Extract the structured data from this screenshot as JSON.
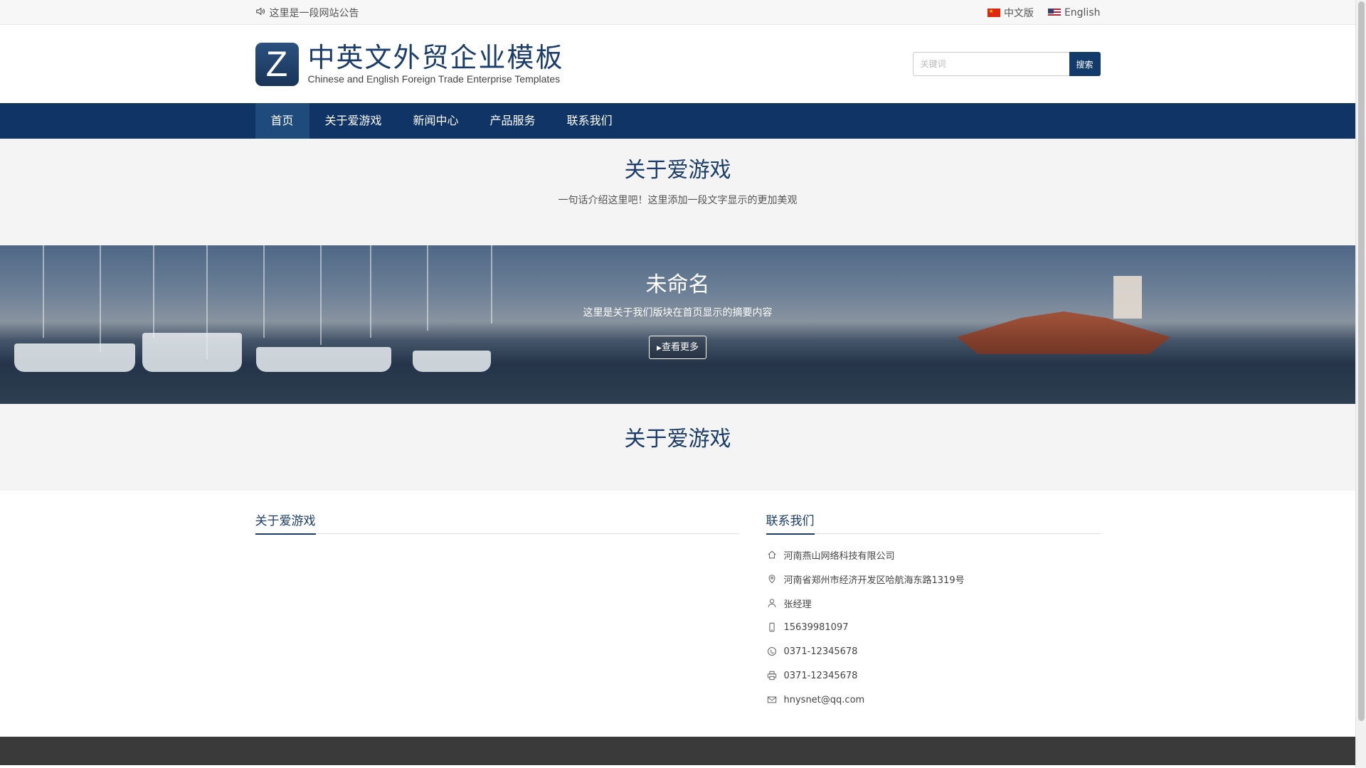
{
  "topbar": {
    "announcement": "这里是一段网站公告",
    "lang_cn": "中文版",
    "lang_en": "English"
  },
  "header": {
    "logo_letter": "Z",
    "title_cn": "中英文外贸企业模板",
    "title_en": "Chinese and English Foreign Trade Enterprise Templates",
    "search_placeholder": "关键词",
    "search_button": "搜索"
  },
  "nav": {
    "items": [
      {
        "label": "首页"
      },
      {
        "label": "关于爱游戏"
      },
      {
        "label": "新闻中心"
      },
      {
        "label": "产品服务"
      },
      {
        "label": "联系我们"
      }
    ]
  },
  "intro": {
    "title": "关于爱游戏",
    "subtitle": "一句话介绍这里吧！这里添加一段文字显示的更加美观"
  },
  "banner": {
    "title": "未命名",
    "summary": "这里是关于我们版块在首页显示的摘要内容",
    "more_button": "查看更多"
  },
  "about2": {
    "title": "关于爱游戏"
  },
  "bottom": {
    "left_title": "关于爱游戏",
    "right_title": "联系我们",
    "contacts": [
      {
        "icon": "home-icon",
        "text": "河南燕山网络科技有限公司"
      },
      {
        "icon": "location-icon",
        "text": "河南省郑州市经济开发区哈航海东路1319号"
      },
      {
        "icon": "user-icon",
        "text": "张经理"
      },
      {
        "icon": "mobile-icon",
        "text": "15639981097"
      },
      {
        "icon": "phone-icon",
        "text": "0371-12345678"
      },
      {
        "icon": "fax-icon",
        "text": "0371-12345678"
      },
      {
        "icon": "email-icon",
        "text": "hnysnet@qq.com"
      }
    ]
  },
  "colors": {
    "primary": "#0f3465",
    "nav_active": "#1f4a7c",
    "title_blue": "#1b3d6b",
    "section_bg": "#f4f4f4",
    "footer": "#3a3a3a"
  }
}
